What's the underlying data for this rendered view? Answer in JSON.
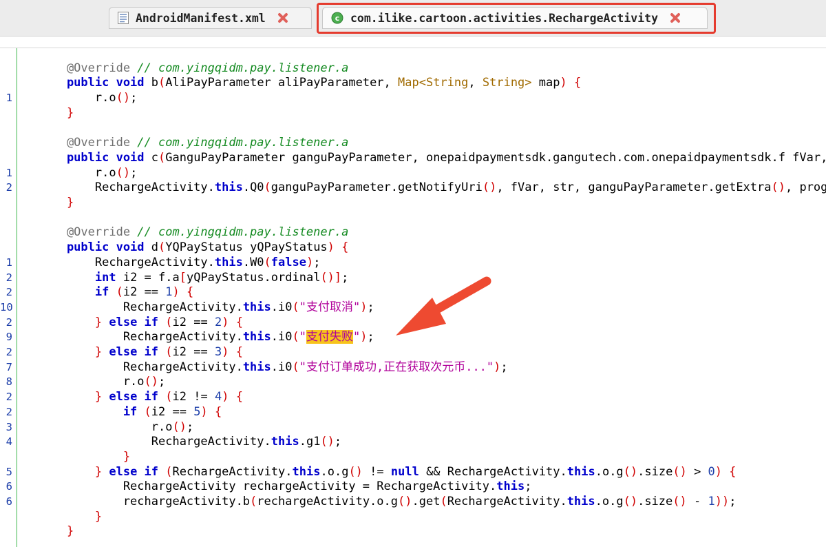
{
  "tabs": [
    {
      "label": "AndroidManifest.xml",
      "icon": "xml-file-icon"
    },
    {
      "label": "com.ilike.cartoon.activities.RechargeActivity",
      "icon": "class-icon"
    }
  ],
  "colors": {
    "accent_red": "#e53b2e",
    "gutter_green": "#3bb64a",
    "keyword_blue": "#0000cc",
    "comment_green": "#138a20",
    "string_magenta": "#b0009a",
    "highlight_yellow": "#f7c31c"
  },
  "lines": [
    {
      "n": "",
      "segs": [
        [
          "",
          ""
        ]
      ]
    },
    {
      "n": "",
      "segs": [
        [
          "ann",
          "    @Override "
        ],
        [
          "cmt",
          "// com.yingqidm.pay.listener.a"
        ]
      ]
    },
    {
      "n": "",
      "segs": [
        [
          "kw",
          "    public void "
        ],
        [
          "",
          "b"
        ],
        [
          "par",
          "("
        ],
        [
          "",
          "AliPayParameter aliPayParameter, "
        ],
        [
          "type",
          "Map<String"
        ],
        [
          "",
          ", "
        ],
        [
          "type",
          "String>"
        ],
        [
          "",
          " map"
        ],
        [
          "par",
          ")"
        ],
        [
          "",
          " "
        ],
        [
          "par",
          "{"
        ]
      ]
    },
    {
      "n": "1",
      "segs": [
        [
          "",
          "        r.o"
        ],
        [
          "par",
          "()"
        ],
        [
          "",
          ";"
        ]
      ]
    },
    {
      "n": "",
      "segs": [
        [
          "par",
          "    }"
        ]
      ]
    },
    {
      "n": "",
      "segs": [
        [
          "",
          ""
        ]
      ]
    },
    {
      "n": "",
      "segs": [
        [
          "ann",
          "    @Override "
        ],
        [
          "cmt",
          "// com.yingqidm.pay.listener.a"
        ]
      ]
    },
    {
      "n": "",
      "segs": [
        [
          "kw",
          "    public void "
        ],
        [
          "",
          "c"
        ],
        [
          "par",
          "("
        ],
        [
          "",
          "GanguPayParameter ganguPayParameter, onepaidpaymentsdk.gangutech.com.onepaidpaymentsdk.f fVar,"
        ]
      ]
    },
    {
      "n": "1",
      "segs": [
        [
          "",
          "        r.o"
        ],
        [
          "par",
          "()"
        ],
        [
          "",
          ";"
        ]
      ]
    },
    {
      "n": "2",
      "segs": [
        [
          "",
          "        RechargeActivity."
        ],
        [
          "kw",
          "this"
        ],
        [
          "",
          ".Q0"
        ],
        [
          "par",
          "("
        ],
        [
          "",
          "ganguPayParameter.getNotifyUri"
        ],
        [
          "par",
          "()"
        ],
        [
          "",
          ", fVar, str, ganguPayParameter.getExtra"
        ],
        [
          "par",
          "()"
        ],
        [
          "",
          ", prog"
        ]
      ]
    },
    {
      "n": "",
      "segs": [
        [
          "par",
          "    }"
        ]
      ]
    },
    {
      "n": "",
      "segs": [
        [
          "",
          ""
        ]
      ]
    },
    {
      "n": "",
      "segs": [
        [
          "ann",
          "    @Override "
        ],
        [
          "cmt",
          "// com.yingqidm.pay.listener.a"
        ]
      ]
    },
    {
      "n": "",
      "segs": [
        [
          "kw",
          "    public void "
        ],
        [
          "",
          "d"
        ],
        [
          "par",
          "("
        ],
        [
          "",
          "YQPayStatus yQPayStatus"
        ],
        [
          "par",
          ")"
        ],
        [
          "",
          " "
        ],
        [
          "par",
          "{"
        ]
      ]
    },
    {
      "n": "1",
      "segs": [
        [
          "",
          "        RechargeActivity."
        ],
        [
          "kw",
          "this"
        ],
        [
          "",
          ".W0"
        ],
        [
          "par",
          "("
        ],
        [
          "kw",
          "false"
        ],
        [
          "par",
          ")"
        ],
        [
          "",
          ";"
        ]
      ]
    },
    {
      "n": "2",
      "segs": [
        [
          "kw",
          "        int"
        ],
        [
          "",
          " i2 = f.a"
        ],
        [
          "par",
          "["
        ],
        [
          "",
          "yQPayStatus.ordinal"
        ],
        [
          "par",
          "()]"
        ],
        [
          "",
          ";"
        ]
      ]
    },
    {
      "n": "2",
      "segs": [
        [
          "kw",
          "        if"
        ],
        [
          "",
          " "
        ],
        [
          "par",
          "("
        ],
        [
          "",
          "i2 == "
        ],
        [
          "num-lit",
          "1"
        ],
        [
          "par",
          ")"
        ],
        [
          "",
          " "
        ],
        [
          "par",
          "{"
        ]
      ]
    },
    {
      "n": "10",
      "segs": [
        [
          "",
          "            RechargeActivity."
        ],
        [
          "kw",
          "this"
        ],
        [
          "",
          ".i0"
        ],
        [
          "par",
          "("
        ],
        [
          "str",
          "\"支付取消\""
        ],
        [
          "par",
          ")"
        ],
        [
          "",
          ";"
        ]
      ]
    },
    {
      "n": "2",
      "segs": [
        [
          "par",
          "        }"
        ],
        [
          "",
          " "
        ],
        [
          "kw",
          "else if"
        ],
        [
          "",
          " "
        ],
        [
          "par",
          "("
        ],
        [
          "",
          "i2 == "
        ],
        [
          "num-lit",
          "2"
        ],
        [
          "par",
          ")"
        ],
        [
          "",
          " "
        ],
        [
          "par",
          "{"
        ]
      ]
    },
    {
      "n": "9",
      "segs": [
        [
          "",
          "            RechargeActivity."
        ],
        [
          "kw",
          "this"
        ],
        [
          "",
          ".i0"
        ],
        [
          "par",
          "("
        ],
        [
          "str",
          "\""
        ],
        [
          "hlstr",
          "支付失败"
        ],
        [
          "str",
          "\""
        ],
        [
          "par",
          ")"
        ],
        [
          "",
          ";"
        ]
      ]
    },
    {
      "n": "2",
      "segs": [
        [
          "par",
          "        }"
        ],
        [
          "",
          " "
        ],
        [
          "kw",
          "else if"
        ],
        [
          "",
          " "
        ],
        [
          "par",
          "("
        ],
        [
          "",
          "i2 == "
        ],
        [
          "num-lit",
          "3"
        ],
        [
          "par",
          ")"
        ],
        [
          "",
          " "
        ],
        [
          "par",
          "{"
        ]
      ]
    },
    {
      "n": "7",
      "segs": [
        [
          "",
          "            RechargeActivity."
        ],
        [
          "kw",
          "this"
        ],
        [
          "",
          ".i0"
        ],
        [
          "par",
          "("
        ],
        [
          "str",
          "\"支付订单成功,正在获取次元币...\""
        ],
        [
          "par",
          ")"
        ],
        [
          "",
          ";"
        ]
      ]
    },
    {
      "n": "8",
      "segs": [
        [
          "",
          "            r.o"
        ],
        [
          "par",
          "()"
        ],
        [
          "",
          ";"
        ]
      ]
    },
    {
      "n": "2",
      "segs": [
        [
          "par",
          "        }"
        ],
        [
          "",
          " "
        ],
        [
          "kw",
          "else if"
        ],
        [
          "",
          " "
        ],
        [
          "par",
          "("
        ],
        [
          "",
          "i2 != "
        ],
        [
          "num-lit",
          "4"
        ],
        [
          "par",
          ")"
        ],
        [
          "",
          " "
        ],
        [
          "par",
          "{"
        ]
      ]
    },
    {
      "n": "2",
      "segs": [
        [
          "kw",
          "            if"
        ],
        [
          "",
          " "
        ],
        [
          "par",
          "("
        ],
        [
          "",
          "i2 == "
        ],
        [
          "num-lit",
          "5"
        ],
        [
          "par",
          ")"
        ],
        [
          "",
          " "
        ],
        [
          "par",
          "{"
        ]
      ]
    },
    {
      "n": "3",
      "segs": [
        [
          "",
          "                r.o"
        ],
        [
          "par",
          "()"
        ],
        [
          "",
          ";"
        ]
      ]
    },
    {
      "n": "4",
      "segs": [
        [
          "",
          "                RechargeActivity."
        ],
        [
          "kw",
          "this"
        ],
        [
          "",
          ".g1"
        ],
        [
          "par",
          "()"
        ],
        [
          "",
          ";"
        ]
      ]
    },
    {
      "n": "",
      "segs": [
        [
          "par",
          "            }"
        ]
      ]
    },
    {
      "n": "5",
      "segs": [
        [
          "par",
          "        }"
        ],
        [
          "",
          " "
        ],
        [
          "kw",
          "else if"
        ],
        [
          "",
          " "
        ],
        [
          "par",
          "("
        ],
        [
          "",
          "RechargeActivity."
        ],
        [
          "kw",
          "this"
        ],
        [
          "",
          ".o.g"
        ],
        [
          "par",
          "()"
        ],
        [
          "",
          " != "
        ],
        [
          "kw",
          "null"
        ],
        [
          "",
          " && RechargeActivity."
        ],
        [
          "kw",
          "this"
        ],
        [
          "",
          ".o.g"
        ],
        [
          "par",
          "()"
        ],
        [
          "",
          ".size"
        ],
        [
          "par",
          "()"
        ],
        [
          "",
          " > "
        ],
        [
          "num-lit",
          "0"
        ],
        [
          "par",
          ")"
        ],
        [
          "",
          " "
        ],
        [
          "par",
          "{"
        ]
      ]
    },
    {
      "n": "6",
      "segs": [
        [
          "",
          "            RechargeActivity rechargeActivity = RechargeActivity."
        ],
        [
          "kw",
          "this"
        ],
        [
          "",
          ";"
        ]
      ]
    },
    {
      "n": "6",
      "segs": [
        [
          "",
          "            rechargeActivity.b"
        ],
        [
          "par",
          "("
        ],
        [
          "",
          "rechargeActivity.o.g"
        ],
        [
          "par",
          "()"
        ],
        [
          "",
          ".get"
        ],
        [
          "par",
          "("
        ],
        [
          "",
          "RechargeActivity."
        ],
        [
          "kw",
          "this"
        ],
        [
          "",
          ".o.g"
        ],
        [
          "par",
          "()"
        ],
        [
          "",
          ".size"
        ],
        [
          "par",
          "()"
        ],
        [
          "",
          " - "
        ],
        [
          "num-lit",
          "1"
        ],
        [
          "par",
          "))"
        ],
        [
          "",
          ";"
        ]
      ]
    },
    {
      "n": "",
      "segs": [
        [
          "par",
          "        }"
        ]
      ]
    },
    {
      "n": "",
      "segs": [
        [
          "par",
          "    }"
        ]
      ]
    }
  ]
}
